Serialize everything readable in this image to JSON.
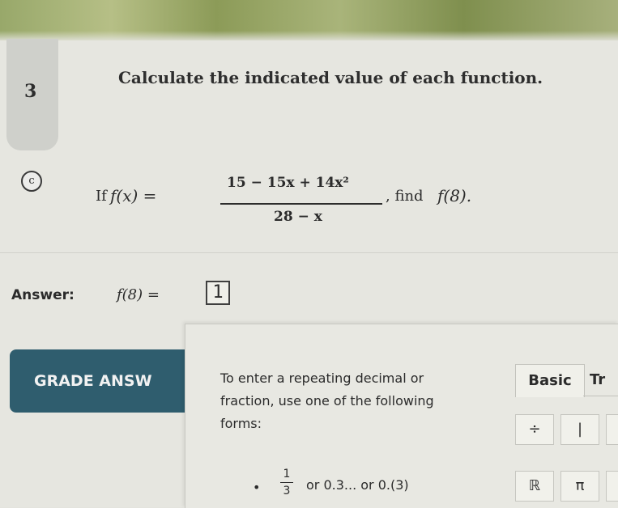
{
  "question": {
    "number": "3",
    "prompt": "Calculate the indicated value of each function.",
    "part_label": "c",
    "if_word": "If",
    "function_lhs": "f(x) =",
    "numerator": "15 − 15x + 14x²",
    "denominator": "28 − x",
    "find_text": ", find",
    "find_expr": "f(8)."
  },
  "answer": {
    "label": "Answer:",
    "expression": "f(8) =",
    "value": "1"
  },
  "grade_button": {
    "label": "GRADE ANSW"
  },
  "help": {
    "text": "To enter a repeating decimal or fraction, use one of the following forms:",
    "bullet": "•",
    "frac_numerator": "1",
    "frac_denominator": "3",
    "forms": "or 0.3... or 0.(3)"
  },
  "keypad": {
    "tabs": [
      "Basic",
      "Tr"
    ],
    "keys": [
      "÷",
      "|",
      "ℝ",
      "π"
    ]
  }
}
